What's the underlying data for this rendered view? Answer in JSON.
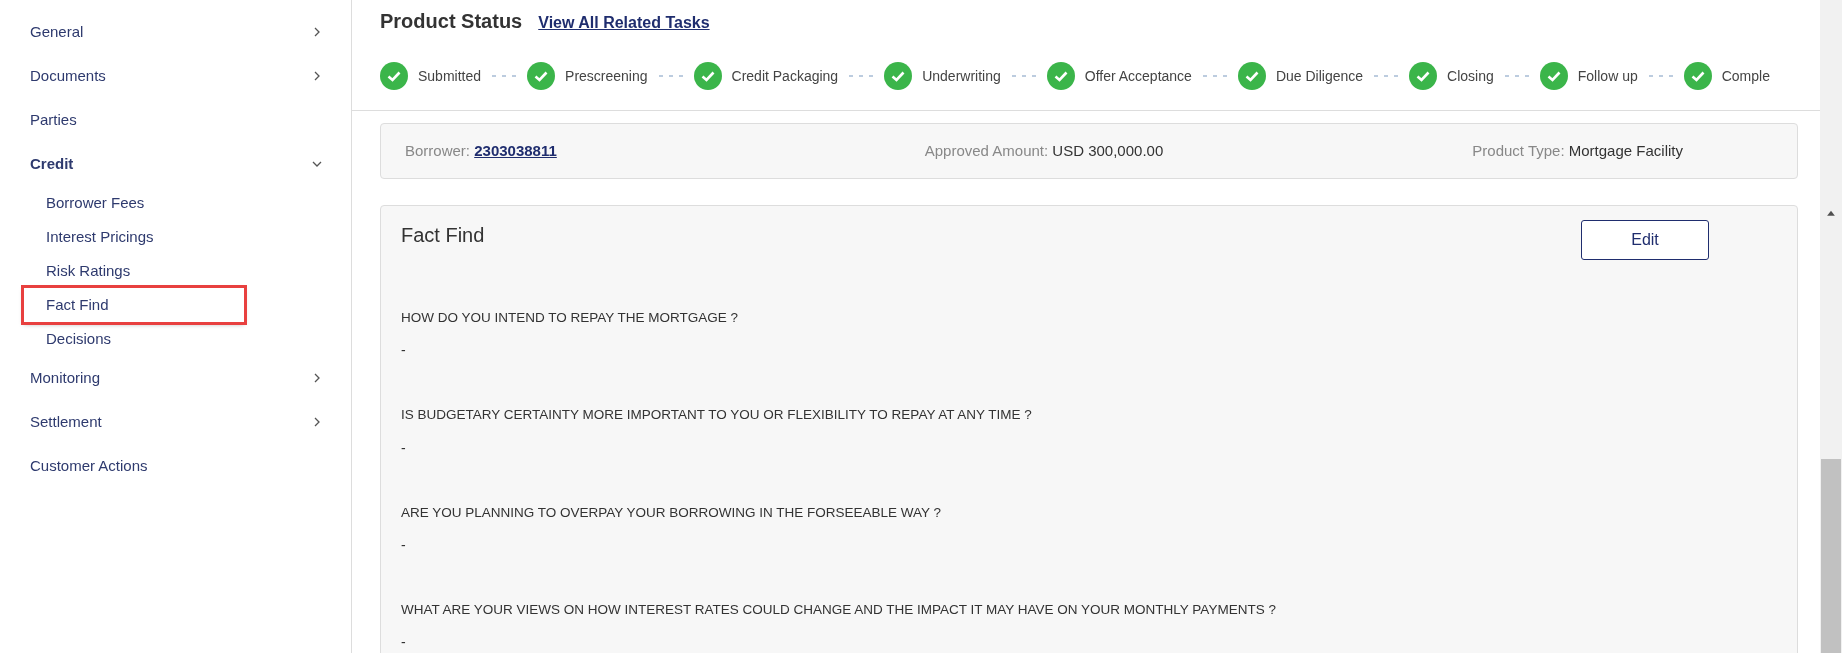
{
  "sidebar": {
    "items": [
      {
        "label": "General",
        "kind": "group",
        "expanded": false
      },
      {
        "label": "Documents",
        "kind": "group",
        "expanded": false
      },
      {
        "label": "Parties",
        "kind": "link"
      },
      {
        "label": "Credit",
        "kind": "group",
        "expanded": true,
        "children": [
          {
            "label": "Borrower Fees",
            "selected": false
          },
          {
            "label": "Interest Pricings",
            "selected": false
          },
          {
            "label": "Risk Ratings",
            "selected": false
          },
          {
            "label": "Fact Find",
            "selected": true
          },
          {
            "label": "Decisions",
            "selected": false
          }
        ]
      },
      {
        "label": "Monitoring",
        "kind": "group",
        "expanded": false
      },
      {
        "label": "Settlement",
        "kind": "group",
        "expanded": false
      },
      {
        "label": "Customer Actions",
        "kind": "link"
      }
    ]
  },
  "product_status": {
    "title": "Product Status",
    "link": "View All Related Tasks",
    "steps": [
      {
        "label": "Submitted",
        "done": true
      },
      {
        "label": "Prescreening",
        "done": true
      },
      {
        "label": "Credit Packaging",
        "done": true
      },
      {
        "label": "Underwriting",
        "done": true
      },
      {
        "label": "Offer Acceptance",
        "done": true
      },
      {
        "label": "Due Diligence",
        "done": true
      },
      {
        "label": "Closing",
        "done": true
      },
      {
        "label": "Follow up",
        "done": true
      },
      {
        "label": "Comple",
        "done": true
      }
    ]
  },
  "summary": [
    {
      "label": "Borrower:",
      "value": "2303038811",
      "kind": "link"
    },
    {
      "label": "Approved Amount:",
      "value": "USD 300,000.00",
      "kind": "text"
    },
    {
      "label": "Product Type:",
      "value": "Mortgage Facility",
      "kind": "text"
    }
  ],
  "fact_find": {
    "title": "Fact Find",
    "button": "Edit",
    "questions": [
      {
        "question": "HOW DO YOU INTEND TO REPAY THE MORTGAGE ?",
        "answer": "-"
      },
      {
        "question": "IS BUDGETARY CERTAINTY MORE IMPORTANT TO YOU OR FLEXIBILITY TO REPAY AT ANY TIME ?",
        "answer": "-"
      },
      {
        "question": "ARE YOU PLANNING TO OVERPAY YOUR BORROWING IN THE FORSEEABLE WAY ?",
        "answer": "-"
      },
      {
        "question": "WHAT ARE YOUR VIEWS ON HOW INTEREST RATES COULD CHANGE AND THE IMPACT IT MAY HAVE ON YOUR MONTHLY PAYMENTS ?",
        "answer": "-"
      }
    ]
  }
}
